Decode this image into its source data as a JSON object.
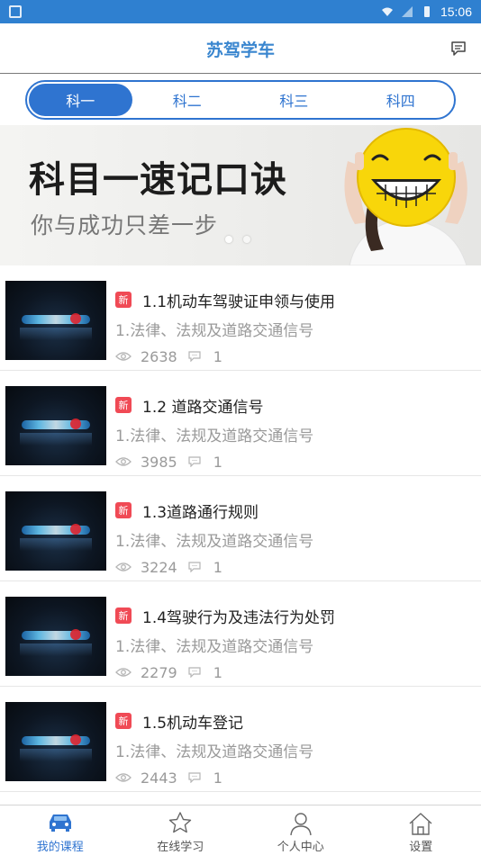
{
  "statusbar": {
    "time": "15:06"
  },
  "appbar": {
    "title": "苏驾学车",
    "message_icon": "message-icon"
  },
  "subjects": [
    "科一",
    "科二",
    "科三",
    "科四"
  ],
  "banner": {
    "title": "科目一速记口诀",
    "subtitle": "你与成功只差一步"
  },
  "courses": [
    {
      "badge": "新",
      "title": "1.1机动车驾驶证申领与使用",
      "subtitle": "1.法律、法规及道路交通信号",
      "views": "2638",
      "comments": "1"
    },
    {
      "badge": "新",
      "title": "1.2 道路交通信号",
      "subtitle": "1.法律、法规及道路交通信号",
      "views": "3985",
      "comments": "1"
    },
    {
      "badge": "新",
      "title": "1.3道路通行规则",
      "subtitle": "1.法律、法规及道路交通信号",
      "views": "3224",
      "comments": "1"
    },
    {
      "badge": "新",
      "title": "1.4驾驶行为及违法行为处罚",
      "subtitle": "1.法律、法规及道路交通信号",
      "views": "2279",
      "comments": "1"
    },
    {
      "badge": "新",
      "title": "1.5机动车登记",
      "subtitle": "1.法律、法规及道路交通信号",
      "views": "2443",
      "comments": "1"
    }
  ],
  "tabbar": [
    {
      "label": "我的课程",
      "icon": "car-icon"
    },
    {
      "label": "在线学习",
      "icon": "star-icon"
    },
    {
      "label": "个人中心",
      "icon": "person-icon"
    },
    {
      "label": "设置",
      "icon": "home-icon"
    }
  ],
  "colors": {
    "accent": "#2f74d0",
    "badge": "#f04a55",
    "title": "#3a86cf"
  }
}
